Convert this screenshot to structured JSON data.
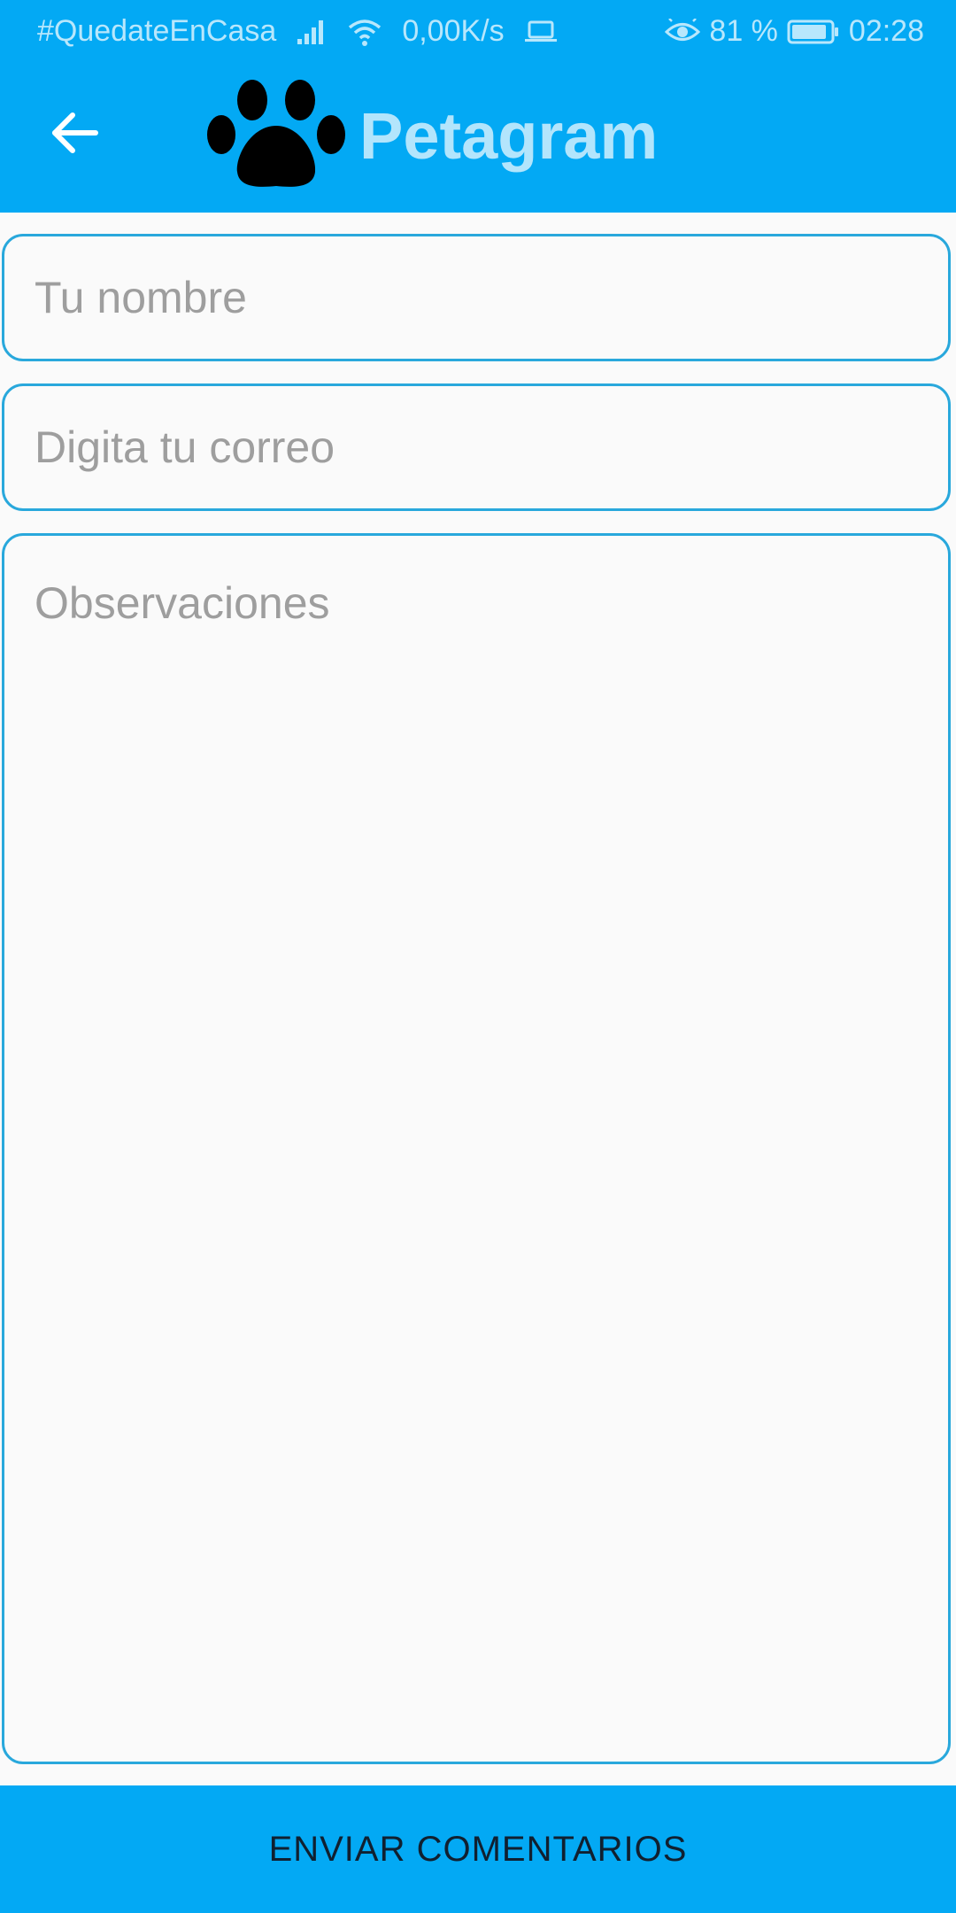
{
  "status_bar": {
    "carrier_text": "#QuedateEnCasa",
    "network_speed": "0,00K/s",
    "battery_percent": "81 %",
    "time": "02:28",
    "icons": [
      "signal-icon",
      "wifi-icon",
      "laptop-icon",
      "eye-icon",
      "battery-icon"
    ]
  },
  "app_bar": {
    "title": "Petagram",
    "back_icon": "arrow-left-icon",
    "logo_icon": "paw-icon",
    "title_color": "#b3e5fc",
    "background_color": "#03a9f4"
  },
  "form": {
    "name_placeholder": "Tu nombre",
    "name_value": "",
    "email_placeholder": "Digita tu correo",
    "email_value": "",
    "observations_placeholder": "Observaciones",
    "observations_value": "",
    "border_color": "#29a8dc"
  },
  "footer": {
    "send_label": "ENVIAR COMENTARIOS"
  }
}
